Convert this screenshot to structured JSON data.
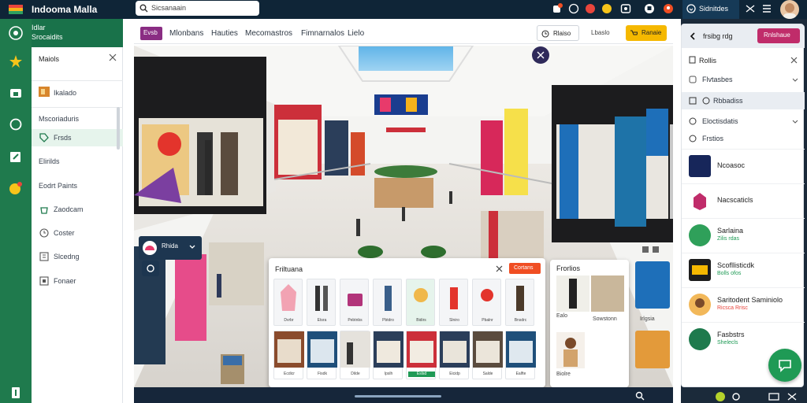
{
  "app": {
    "title": "Indooma Malla"
  },
  "search": {
    "placeholder": "Sicsanaain"
  },
  "topbar": {
    "signin_label": "Sidnitdes"
  },
  "brand": {
    "line1": "Idlar",
    "line2": "Srocaidits"
  },
  "menu": {
    "title": "Maiols",
    "items": [
      {
        "label": "Ikalado",
        "icon": "store-icon"
      },
      {
        "label": "Mscoriaduris",
        "icon": "category-icon"
      },
      {
        "label": "Frsds",
        "icon": "tag-icon"
      },
      {
        "label": "Elirilds",
        "icon": "grid-icon"
      },
      {
        "label": "Eodrt Paints",
        "icon": "map-icon"
      },
      {
        "label": "Zaodcam",
        "icon": "bag-icon"
      },
      {
        "label": "Coster",
        "icon": "clock-icon"
      },
      {
        "label": "Slcedng",
        "icon": "list-icon"
      },
      {
        "label": "Fonaer",
        "icon": "box-icon"
      }
    ]
  },
  "toolbar": {
    "badge": "Evsb",
    "tabs": [
      "Mlonbans",
      "Hauties",
      "Mecomastros",
      "Fimnarnalos",
      "Lielo"
    ],
    "btn_tour": "Rlaiso",
    "btn_login": "Lbaslo",
    "btn_cart": "Ranaie"
  },
  "storecard": {
    "title": "Rhida"
  },
  "popup": {
    "title": "Friltuana",
    "action": "Cortans",
    "products": [
      "Dvrbr",
      "Etsra",
      "Pebtnbs",
      "Pbtdro",
      "Bidirs",
      "Slniro",
      "Pbalnr",
      "Bnsdrc"
    ],
    "stores": [
      "Ecdicr",
      "Fisdk",
      "Dilde",
      "Ipslh",
      "Eslsd",
      "Eicidp",
      "Salde",
      "Ealfte"
    ]
  },
  "featured": {
    "title": "Frorlios",
    "items": [
      "Ealo",
      "Sowstonn",
      "Biolre",
      "Irlgsia"
    ]
  },
  "rpanel": {
    "header_label": "frsibg rdg",
    "header_btn": "Rnlshaue",
    "subtitle": "Rollis",
    "filters": [
      "Flvtasbes",
      "Rbbadiss",
      "Eloctisdatis",
      "Frstios"
    ],
    "list": [
      {
        "name": "Ncoasoc",
        "sub": ""
      },
      {
        "name": "Nacscaticls",
        "sub": ""
      },
      {
        "name": "Sarlaina",
        "sub": "Zilis rdas"
      },
      {
        "name": "Scofllisticdk",
        "sub": "Bolls ofos"
      },
      {
        "name": "Saritodent Saminiolo",
        "sub": "Ricsca Rrisc"
      },
      {
        "name": "Fasbstrs",
        "sub": "Shelecls"
      }
    ]
  },
  "colors": {
    "primary_green": "#1f7a4d",
    "accent_orange": "#f04e23",
    "navy": "#0f2537",
    "cart_yellow": "#f5b800"
  }
}
